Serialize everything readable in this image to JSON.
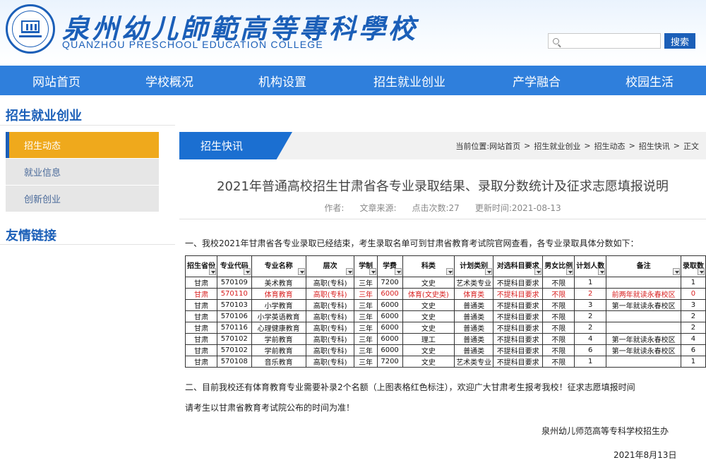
{
  "header": {
    "school_name_cn": "泉州幼儿師範高等專科學校",
    "school_name_en": "QUANZHOU PRESCHOOL EDUCATION COLLEGE",
    "logo_icon": "school-seal-icon",
    "search_placeholder": "",
    "search_button": "搜索"
  },
  "nav": [
    "网站首页",
    "学校概况",
    "机构设置",
    "招生就业创业",
    "产学融合",
    "校园生活"
  ],
  "sidebar": {
    "title": "招生就业创业",
    "items": [
      {
        "label": "招生动态",
        "active": true
      },
      {
        "label": "就业信息",
        "active": false
      },
      {
        "label": "创新创业",
        "active": false
      }
    ],
    "friend_links_title": "友情链接"
  },
  "main": {
    "tab_label": "招生快讯",
    "breadcrumb": [
      "当前位置:",
      "网站首页",
      "招生就业创业",
      "招生动态",
      "招生快讯",
      "正文"
    ]
  },
  "article": {
    "title": "2021年普通高校招生甘肃省各专业录取结果、录取分数统计及征求志愿填报说明",
    "meta": {
      "author": "作者:",
      "source": "文章来源:",
      "clicks": "点击次数:27",
      "updated": "更新时间:2021-08-13"
    },
    "para1": "一、我校2021年甘肃省各专业录取已经结束，考生录取名单可到甘肃省教育考试院官网查看，各专业录取具体分数如下：",
    "para2": "二、目前我校还有体育教育专业需要补录2个名额（上图表格红色标注），欢迎广大甘肃考生报考我校！征求志愿填报时间",
    "para3": "请考生以甘肃省教育考试院公布的时间为准！",
    "signature": "泉州幼儿师范高等专科学校招生办",
    "date": "2021年8月13日"
  },
  "table": {
    "headers": [
      "招生省份",
      "专业代码",
      "专业名称",
      "层次",
      "学制",
      "学费",
      "科类",
      "计划类别",
      "对选科目要求",
      "男女比例",
      "计划人数",
      "备注",
      "录取数"
    ],
    "rows": [
      [
        "甘肃",
        "570109",
        "美术教育",
        "高职(专科)",
        "三年",
        "7200",
        "文史",
        "艺术类专业",
        "不提科目要求",
        "不限",
        "1",
        "",
        "1"
      ],
      [
        "甘肃",
        "570110",
        "体育教育",
        "高职(专科)",
        "三年",
        "6000",
        "体育(文史类)",
        "体育类",
        "不提科目要求",
        "不限",
        "2",
        "前两年就读永春校区",
        "0"
      ],
      [
        "甘肃",
        "570103",
        "小学教育",
        "高职(专科)",
        "三年",
        "6000",
        "文史",
        "普通类",
        "不提科目要求",
        "不限",
        "3",
        "第一年就读永春校区",
        "3"
      ],
      [
        "甘肃",
        "570106",
        "小学英语教育",
        "高职(专科)",
        "三年",
        "6000",
        "文史",
        "普通类",
        "不提科目要求",
        "不限",
        "2",
        "",
        "2"
      ],
      [
        "甘肃",
        "570116",
        "心理健康教育",
        "高职(专科)",
        "三年",
        "6000",
        "文史",
        "普通类",
        "不提科目要求",
        "不限",
        "2",
        "",
        "2"
      ],
      [
        "甘肃",
        "570102",
        "学前教育",
        "高职(专科)",
        "三年",
        "6000",
        "理工",
        "普通类",
        "不提科目要求",
        "不限",
        "4",
        "第一年就读永春校区",
        "4"
      ],
      [
        "甘肃",
        "570102",
        "学前教育",
        "高职(专科)",
        "三年",
        "6000",
        "文史",
        "普通类",
        "不提科目要求",
        "不限",
        "6",
        "第一年就读永春校区",
        "6"
      ],
      [
        "甘肃",
        "570108",
        "音乐教育",
        "高职(专科)",
        "三年",
        "7200",
        "文史",
        "艺术类专业",
        "不提科目要求",
        "不限",
        "1",
        "",
        "1"
      ]
    ],
    "highlight_row": 1,
    "highlight_color": "#d82020"
  },
  "colors": {
    "brand_blue": "#1b5fb8",
    "nav_blue": "#2f7fdc",
    "active_orange": "#efa91c"
  }
}
